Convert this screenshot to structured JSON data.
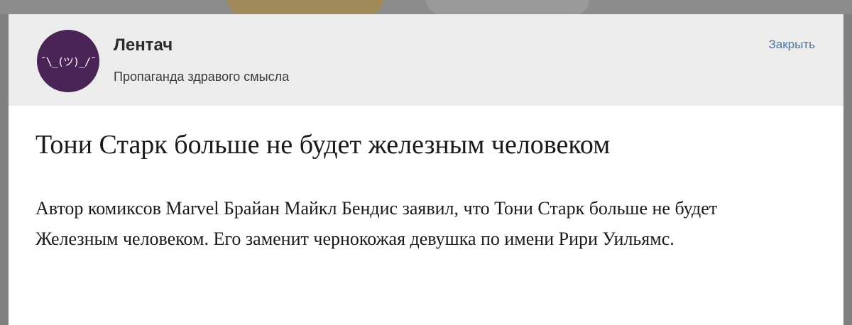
{
  "header": {
    "community_name": "Лентач",
    "community_status": "Пропаганда здравого смысла",
    "avatar_text": "¯\\_(ツ)_/¯",
    "close_label": "Закрыть"
  },
  "article": {
    "title": "Тони Старк больше не будет железным человеком",
    "body": "Автор комиксов Marvel Брайан Майкл Бендис заявил, что Тони Старк больше не будет Железным человеком. Его заменит чернокожая девушка по имени Рири Уильямс."
  },
  "colors": {
    "link": "#4a76a8",
    "header_bg": "#ececec",
    "avatar_bg": "#4a2456",
    "overlay": "#808080"
  },
  "icons": {
    "avatar": "shrug-emoticon-logo"
  }
}
